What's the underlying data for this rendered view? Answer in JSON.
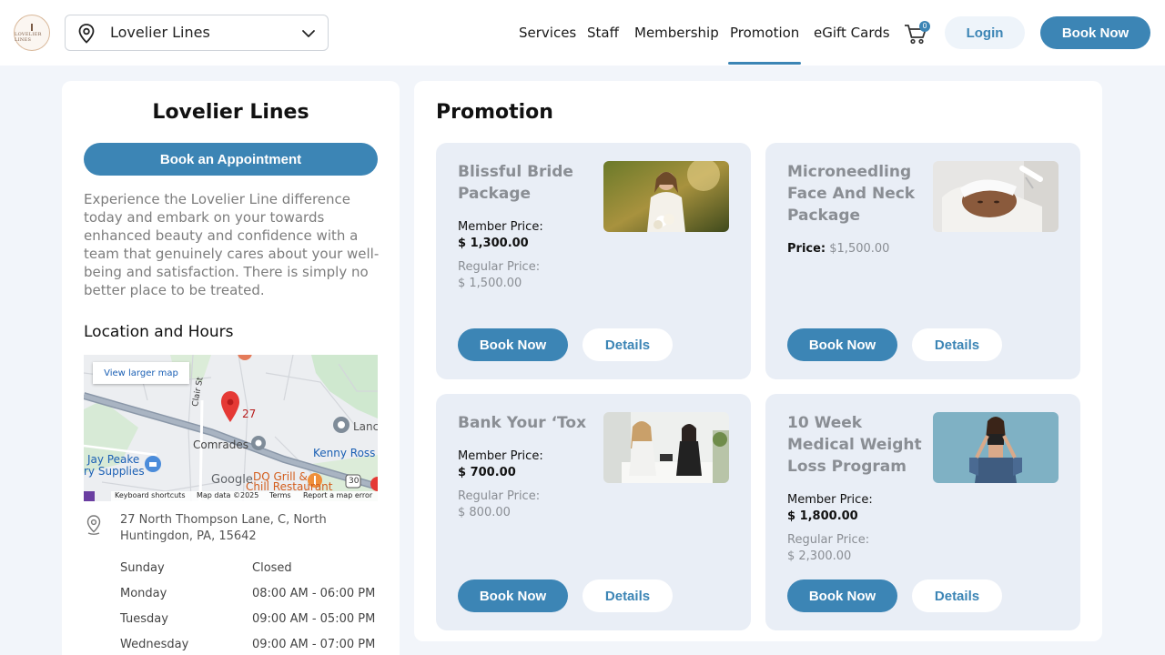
{
  "header": {
    "logo_text": "LOVELIER LINES",
    "location_selected": "Lovelier Lines",
    "nav": [
      {
        "label": "Services"
      },
      {
        "label": "Staff"
      },
      {
        "label": "Membership"
      },
      {
        "label": "Promotion",
        "active": true
      },
      {
        "label": "eGift Cards"
      }
    ],
    "cart_count": "0",
    "login_label": "Login",
    "book_now_label": "Book Now"
  },
  "sidebar": {
    "title": "Lovelier Lines",
    "book_appointment_label": "Book an Appointment",
    "description": "Experience the Lovelier Line difference today and embark on your towards enhanced beauty and confidence with a team that genuinely cares about your well-being and satisfaction. There is simply no better place to be treated.",
    "location_heading": "Location and Hours",
    "map": {
      "view_larger": "View larger map",
      "marker_label": "27",
      "labels": {
        "street": "Clair St",
        "comrades": "Comrades",
        "kenny_ross": "Kenny Ross",
        "jay_peake_1": "Jay Peake",
        "jay_peake_2": "ry Supplies",
        "dq_1": "DQ Grill &",
        "dq_2": "Chill Restaurant",
        "lanc": "Lanc",
        "route": "30",
        "google": "Google"
      },
      "footer": {
        "shortcuts": "Keyboard shortcuts",
        "data": "Map data ©2025",
        "terms": "Terms",
        "report": "Report a map error"
      }
    },
    "address": "27 North Thompson Lane, C, North Huntingdon, PA, 15642",
    "hours": [
      {
        "day": "Sunday",
        "time": "Closed"
      },
      {
        "day": "Monday",
        "time": "08:00 AM - 06:00 PM"
      },
      {
        "day": "Tuesday",
        "time": "09:00 AM - 05:00 PM"
      },
      {
        "day": "Wednesday",
        "time": "09:00 AM - 07:00 PM"
      }
    ]
  },
  "main": {
    "title": "Promotion",
    "cards": [
      {
        "title": "Blissful Bride Package",
        "member_label": "Member Price:",
        "member_price": "$ 1,300.00",
        "regular_label": "Regular Price:",
        "regular_price": "$ 1,500.00",
        "book_label": "Book Now",
        "details_label": "Details"
      },
      {
        "title": "Microneedling Face And Neck Package",
        "price_label": "Price:",
        "price": "$1,500.00",
        "book_label": "Book Now",
        "details_label": "Details"
      },
      {
        "title": "Bank Your ‘Tox",
        "member_label": "Member Price:",
        "member_price": "$ 700.00",
        "regular_label": "Regular Price:",
        "regular_price": "$ 800.00",
        "book_label": "Book Now",
        "details_label": "Details"
      },
      {
        "title": "10 Week Medical Weight Loss Program",
        "member_label": "Member Price:",
        "member_price": "$ 1,800.00",
        "regular_label": "Regular Price:",
        "regular_price": "$ 2,300.00",
        "book_label": "Book Now",
        "details_label": "Details"
      }
    ]
  },
  "colors": {
    "accent": "#3c85b5",
    "background": "#f2f5fa",
    "card_bg": "#e9eef6"
  }
}
